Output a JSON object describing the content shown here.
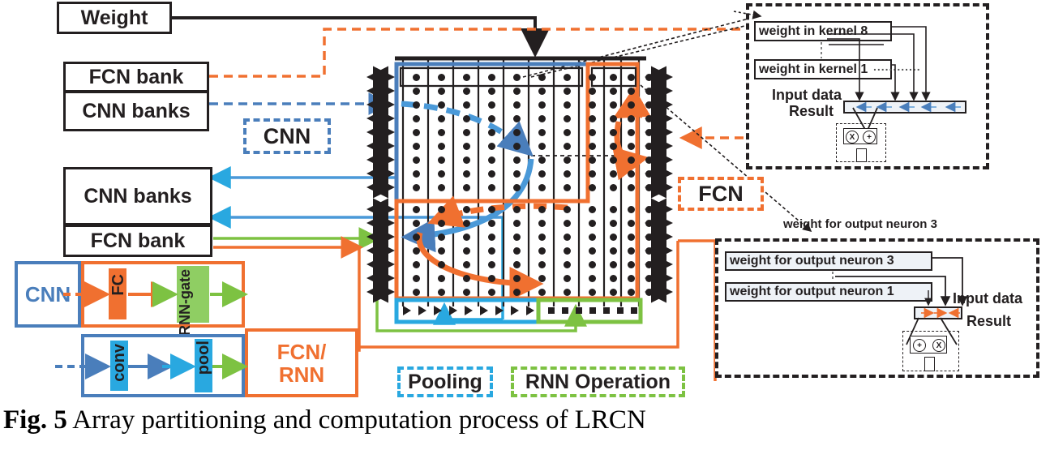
{
  "figure": {
    "caption_prefix": "Fig. 5",
    "caption_text": " Array partitioning and computation process of LRCN"
  },
  "colors": {
    "black": "#231f20",
    "orange": "#f07030",
    "blue": "#4a7ebb",
    "cyan": "#29a8e0",
    "green": "#7dc242",
    "white": "#ffffff"
  },
  "banks": {
    "weight": "Weight",
    "fcn_bank_top": "FCN bank",
    "cnn_banks_top": "CNN banks",
    "cnn_banks_bottom": "CNN banks",
    "fcn_bank_bottom": "FCN bank"
  },
  "legends": {
    "cnn": "CNN",
    "fcn": "FCN",
    "pooling": "Pooling",
    "rnn_operation": "RNN Operation"
  },
  "network": {
    "cnn_label": "CNN",
    "fc_label": "FC",
    "rnn_gate_label": "RNN-gate",
    "conv_label": "conv",
    "pool_label": "pool",
    "fcn_rnn_label_line1": "FCN/",
    "fcn_rnn_label_line2": "RNN"
  },
  "inset_top": {
    "row_top": "weight in kernel 8",
    "row_bottom": "weight in kernel 1",
    "input_data": "Input data",
    "result": "Result",
    "ellipsis": "............",
    "mult_symbol": "X",
    "add_symbol": "+"
  },
  "inset_bottom": {
    "title": "weight for output neuron 3",
    "row_top": "weight for output neuron 3",
    "row_bottom": "weight for output neuron 1",
    "input_data": "Input data",
    "result": "Result",
    "mult_symbol": "X",
    "add_symbol": "+"
  },
  "array": {
    "cnn_columns": 9,
    "cnn_rows": 9,
    "fcn_right_columns": 3,
    "fcn_bottom_rows": 6,
    "pooling_triangles": 9,
    "rnn_squares": 7,
    "total_rows_with_arrows": 16
  }
}
